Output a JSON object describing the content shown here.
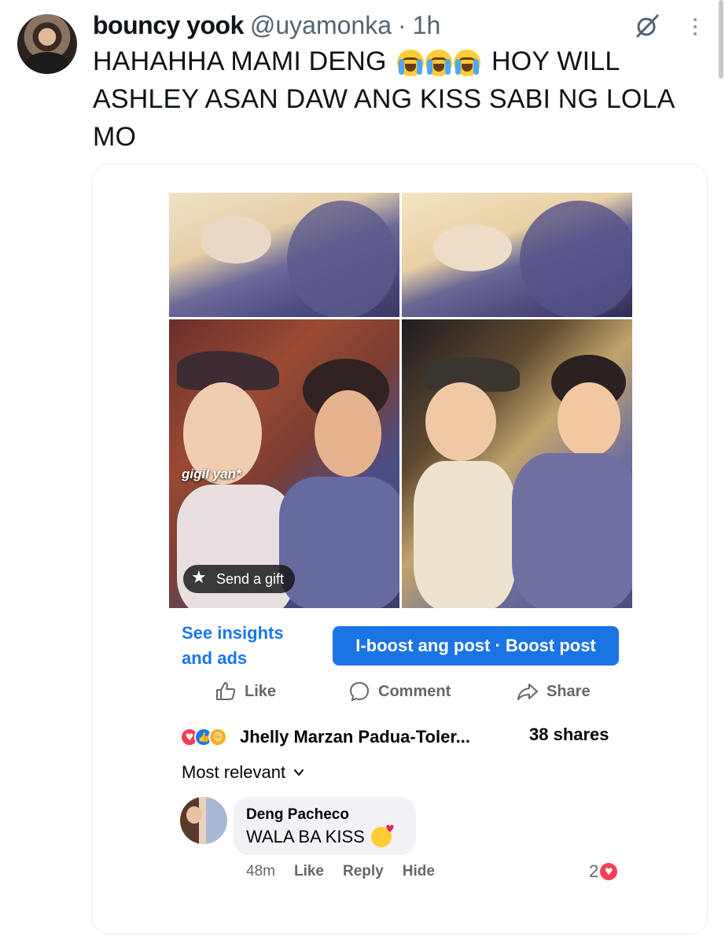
{
  "tweet": {
    "display_name": "bouncy yook",
    "handle": "@uyamonka",
    "separator": "·",
    "time": "1h",
    "text_part1": "HAHAHHA MAMI DENG",
    "text_part2": "HOY WILL ASHLEY ASAN DAW ANG KISS SABI NG LOLA MO",
    "emoji": "loudly-crying-face x3"
  },
  "embedded_post": {
    "photo_caption": "gigil yan*",
    "gift_label": "Send a gift",
    "insights_label": "See insights and ads",
    "boost_label": "I-boost ang post · Boost post",
    "actions": {
      "like": "Like",
      "comment": "Comment",
      "share": "Share"
    },
    "reactions_names": "Jhelly Marzan Padua-Toler...",
    "shares": "38 shares",
    "sort_label": "Most relevant",
    "comment": {
      "author": "Deng Pacheco",
      "text": "WALA BA KISS",
      "time": "48m",
      "like": "Like",
      "reply": "Reply",
      "hide": "Hide",
      "reaction_count": "2"
    }
  },
  "colors": {
    "fb_blue": "#1b74e4",
    "link_blue": "#1877f2",
    "muted": "#65676b",
    "twitter_gray": "#536471"
  }
}
